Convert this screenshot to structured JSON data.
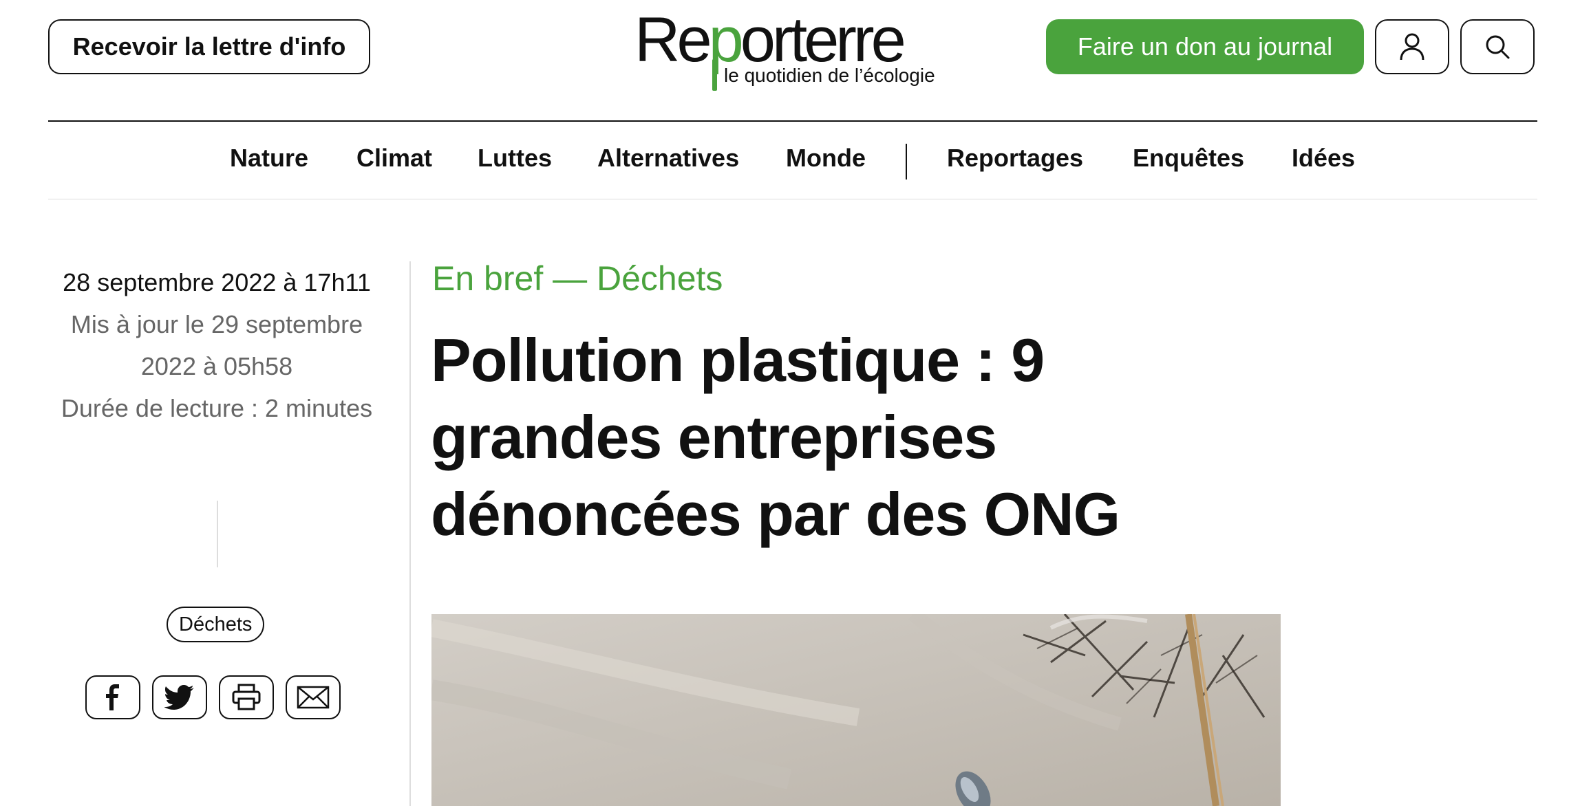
{
  "header": {
    "newsletter_label": "Recevoir la lettre d'info",
    "logo": {
      "name_part1": "Re",
      "name_green": "p",
      "name_part2": "orterre",
      "tagline": "le quotidien de l’écologie"
    },
    "donate_label": "Faire un don au journal",
    "account_icon": "user-icon",
    "search_icon": "search-icon"
  },
  "nav": {
    "items": [
      {
        "label": "Nature"
      },
      {
        "label": "Climat"
      },
      {
        "label": "Luttes"
      },
      {
        "label": "Alternatives"
      },
      {
        "label": "Monde"
      },
      {
        "label": "Reportages"
      },
      {
        "label": "Enquêtes"
      },
      {
        "label": "Idées"
      }
    ]
  },
  "article": {
    "published": "28 septembre 2022 à 17h11",
    "updated": "Mis à jour le 29 septembre 2022 à 05h58",
    "reading_time": "Durée de lecture : 2 minutes",
    "tag": "Déchets",
    "kicker": "En bref — Déchets",
    "title": "Pollution plastique : 9 grandes entreprises dénoncées par des ONG",
    "share_icons": [
      "facebook-icon",
      "twitter-icon",
      "print-icon",
      "mail-icon"
    ]
  },
  "colors": {
    "accent_green": "#4aa33d",
    "text": "#111111",
    "muted": "#666666"
  }
}
